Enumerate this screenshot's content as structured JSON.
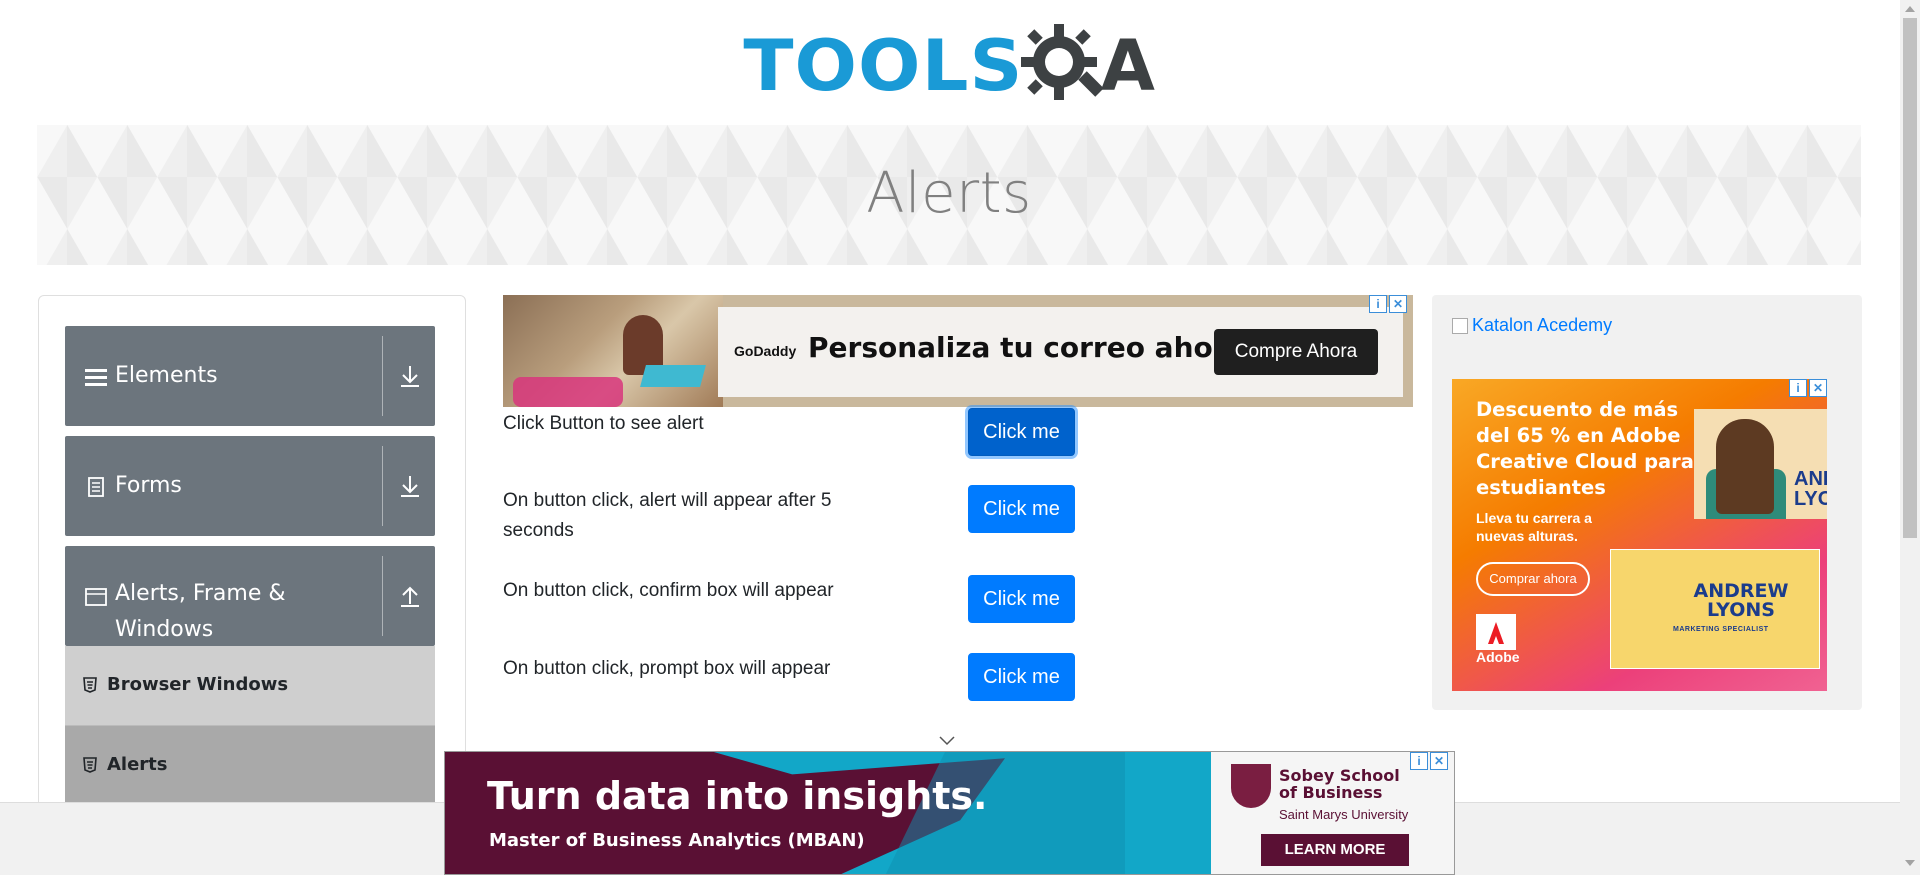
{
  "header": {
    "logo_text_left": "TOOLS",
    "logo_text_right": "A",
    "logo_icon": "gear-magnifier-icon"
  },
  "banner": {
    "title": "Alerts"
  },
  "sidebar": {
    "groups": [
      {
        "label": "Elements",
        "icon": "hamburger-icon",
        "arrow": "download-arrow-icon"
      },
      {
        "label": "Forms",
        "icon": "document-icon",
        "arrow": "download-arrow-icon"
      },
      {
        "label": "Alerts, Frame &",
        "label2": "Windows",
        "icon": "window-icon",
        "arrow": "upload-arrow-icon"
      }
    ],
    "sub_items": [
      {
        "label": "Browser Windows",
        "icon": "html5-icon",
        "active": false
      },
      {
        "label": "Alerts",
        "icon": "html5-icon",
        "active": true
      }
    ]
  },
  "ads": {
    "top": {
      "brand": "GoDaddy",
      "headline": "Personaliza tu correo ahora",
      "cta": "Compre Ahora"
    },
    "right": {
      "broken_link": "Katalon Acedemy",
      "headline": "Descuento de más del 65 % en Adobe Creative Cloud para estudiantes",
      "sub": "Lleva tu carrera a nuevas alturas.",
      "cta": "Comprar ahora",
      "brand": "Adobe",
      "card_name": "ANDREW LYONS",
      "card_role": "MARKETING SPECIALIST",
      "side_name": "AND LYO"
    },
    "bottom": {
      "headline": "Turn data into insights.",
      "sub": "Master of Business Analytics (MBAN)",
      "school_line1": "Sobey School",
      "school_line2": "of Business",
      "university": "Saint Marys University",
      "cta": "LEARN MORE"
    }
  },
  "main": {
    "rows": [
      {
        "label": "Click Button to see alert",
        "button": "Click me"
      },
      {
        "label": "On button click, alert will appear after 5 seconds",
        "button": "Click me"
      },
      {
        "label": "On button click, confirm box will appear",
        "button": "Click me"
      },
      {
        "label": "On button click, prompt box will appear",
        "button": "Click me"
      }
    ]
  },
  "colors": {
    "logo_blue": "#1a9ad6",
    "logo_dark": "#3d4143",
    "sidebar_group": "#6c757d",
    "sub_item_default": "#cfcfcf",
    "sub_item_active": "#a9a9a9",
    "button_primary": "#007bff"
  }
}
